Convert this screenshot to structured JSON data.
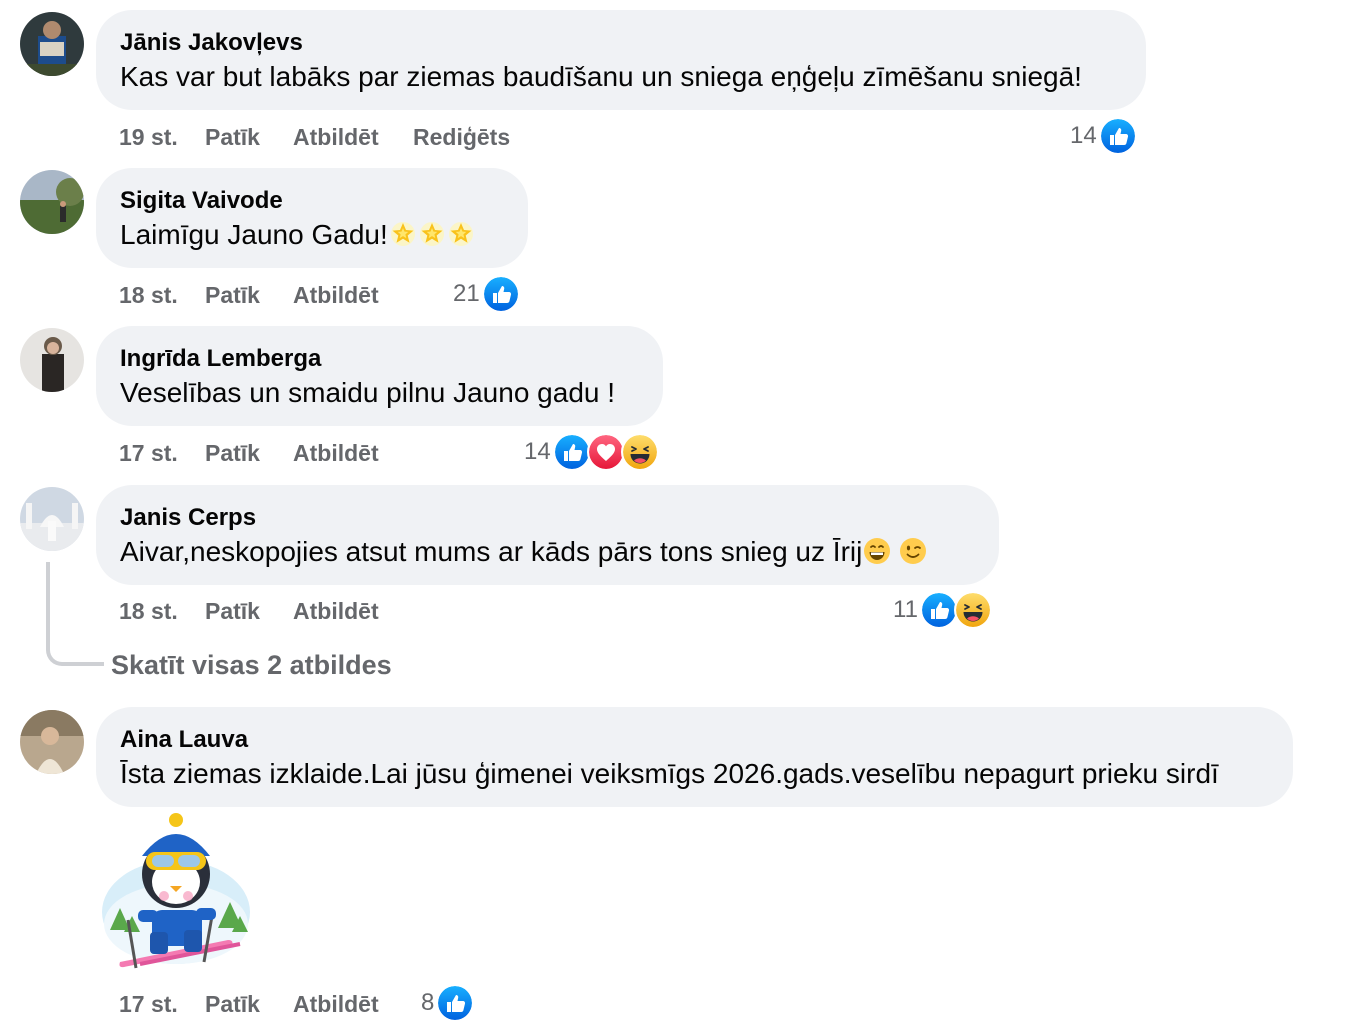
{
  "comments": [
    {
      "author": "Jānis Jakovļevs",
      "text": "Kas var but labāks par ziemas baudīšanu un sniega eņģeļu zīmēšanu sniegā!",
      "time": "19 st.",
      "like": "Patīk",
      "reply": "Atbildēt",
      "edited": "Rediģēts",
      "reaction_count": "14",
      "reactions": [
        "like-icon"
      ]
    },
    {
      "author": "Sigita Vaivode",
      "text": "Laimīgu Jauno Gadu!",
      "text_emojis": [
        "glowing-star-icon",
        "glowing-star-icon",
        "glowing-star-icon"
      ],
      "time": "18 st.",
      "like": "Patīk",
      "reply": "Atbildēt",
      "reaction_count": "21",
      "reactions": [
        "like-icon"
      ]
    },
    {
      "author": "Ingrīda Lemberga",
      "text": "Veselības un smaidu pilnu Jauno gadu !",
      "time": "17 st.",
      "like": "Patīk",
      "reply": "Atbildēt",
      "reaction_count": "14",
      "reactions": [
        "like-icon",
        "care-icon",
        "haha-icon"
      ]
    },
    {
      "author": "Janis Cerps",
      "text": "Aivar,neskopojies atsut mums ar kāds pārs tons snieg uz Īrij",
      "text_emojis": [
        "grinning-face-icon",
        "winking-face-icon"
      ],
      "time": "18 st.",
      "like": "Patīk",
      "reply": "Atbildēt",
      "reaction_count": "11",
      "reactions": [
        "like-icon",
        "haha-icon"
      ],
      "view_replies": "Skatīt visas 2 atbildes"
    },
    {
      "author": "Aina Lauva",
      "text": "Īsta ziemas izklaide.Lai jūsu ģimenei veiksmīgs 2026.gads.veselību nepagurt prieku sirdī",
      "sticker": "penguin-skier-sticker",
      "time": "17 st.",
      "like": "Patīk",
      "reply": "Atbildēt",
      "reaction_count": "8",
      "reactions": [
        "like-icon"
      ]
    }
  ],
  "colors": {
    "bubble": "#f0f2f5",
    "meta_text": "#65676b",
    "like_blue": "#1877f2",
    "care_red": "#f33e58",
    "haha_yellow": "#f7b125"
  }
}
